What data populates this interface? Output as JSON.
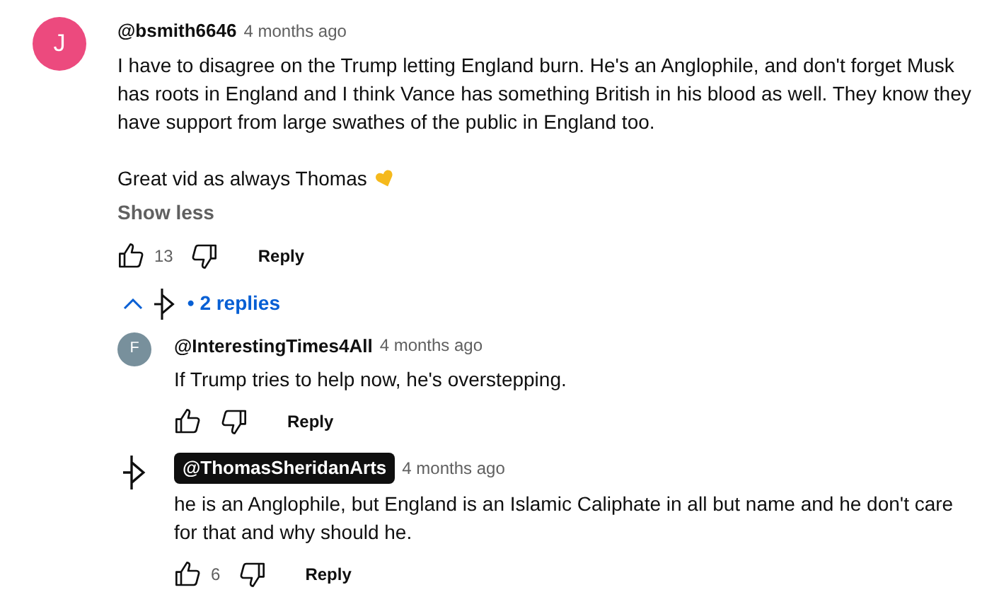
{
  "comment": {
    "avatar_letter": "J",
    "color": "#ec4a7e",
    "author": "@bsmith6646",
    "time": "4 months ago",
    "paragraphs": [
      "I have to disagree on the Trump letting England burn. He's an Anglophile, and don't forget Musk has roots in England and I think Vance has something British in his blood as well. They know they have support from large swathes of the public in England too.",
      "Great vid as always Thomas"
    ],
    "heart_emoji": true,
    "toggle": "Show less",
    "likes": "13",
    "reply": "Reply"
  },
  "replies_toggle": {
    "expanded": true,
    "separator": "•",
    "label": "2 replies"
  },
  "replies": [
    {
      "kind": "user",
      "avatar_letter": "F",
      "color": "#78909c",
      "author": "@InterestingTimes4All",
      "time": "4 months ago",
      "text": "If Trump tries to help now, he's overstepping.",
      "reply": "Reply"
    },
    {
      "kind": "creator",
      "author": "@ThomasSheridanArts",
      "time": "4 months ago",
      "text": "he is an Anglophile, but England is an Islamic Caliphate in all but name and he don't care for that and why should he.",
      "likes": "6",
      "reply": "Reply"
    }
  ]
}
